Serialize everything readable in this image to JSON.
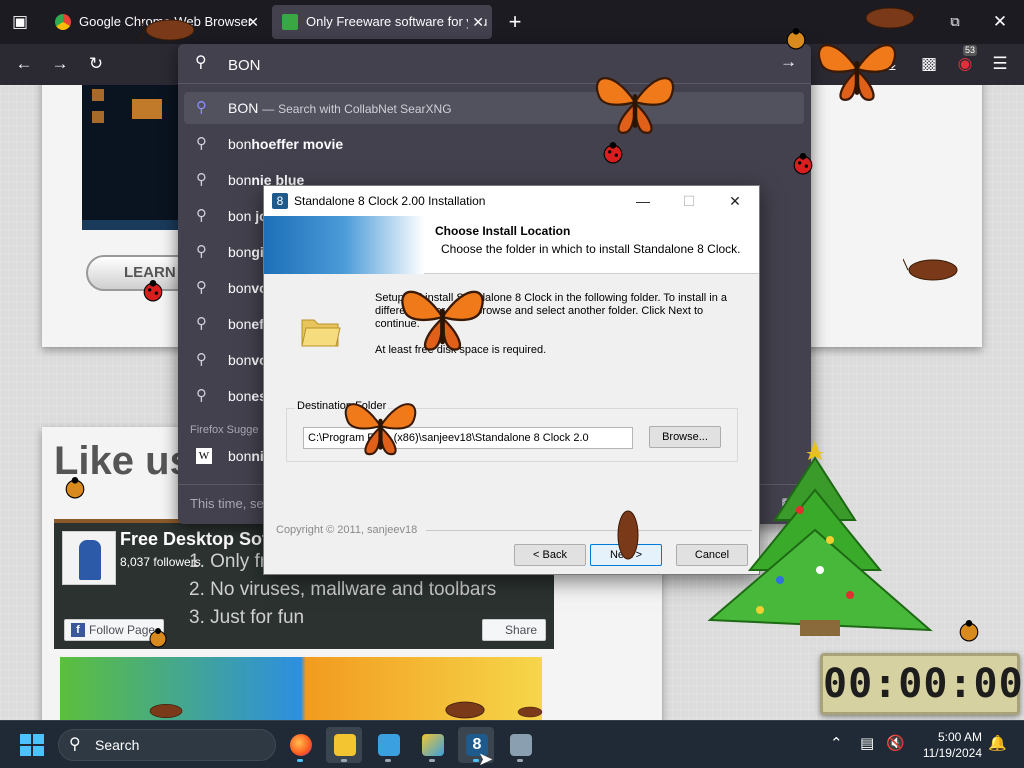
{
  "browser": {
    "tabs": [
      {
        "label": "Google Chrome Web Browser",
        "active": false
      },
      {
        "label": "Only Freeware software for you",
        "active": true
      }
    ],
    "extension_badge": "53"
  },
  "urlbar": {
    "query": "BON",
    "engine_suggestion": {
      "text": "BON",
      "separator": "—",
      "action": "Search with CollabNet SearXNG"
    },
    "suggestions": [
      {
        "prefix": "bon",
        "rest": "hoeffer movie"
      },
      {
        "prefix": "bon",
        "rest": "nie blue"
      },
      {
        "prefix": "bon ",
        "rest": "jo"
      },
      {
        "prefix": "bon",
        "rest": "gi"
      },
      {
        "prefix": "bon",
        "rest": "vo"
      },
      {
        "prefix": "bon",
        "rest": "ef"
      },
      {
        "prefix": "bon",
        "rest": "vo"
      },
      {
        "prefix": "bon",
        "rest": "es"
      }
    ],
    "firefox_heading": "Firefox Sugge",
    "firefox_item": {
      "prefix": "bon",
      "rest": "ni"
    },
    "footer": "This time, se"
  },
  "page": {
    "learn_more": "LEARN M",
    "like_us": "Like us",
    "facebook": {
      "name": "Free Desktop Soft",
      "followers": "8,037 followers",
      "lines": [
        "1. Only fre",
        "2. No viruses, mallware and toolbars",
        "3. Just for fun"
      ],
      "follow_label": "Follow Page",
      "share_label": "Share"
    }
  },
  "installer": {
    "title": "Standalone 8 Clock 2.00 Installation",
    "heading": "Choose Install Location",
    "subheading": "Choose the folder in which to install Standalone 8 Clock.",
    "body_line1": "Setup will install Standalone 8 Clock in the following folder. To install in a",
    "body_line2": "different folder, click Browse and select another folder. Click Next to",
    "body_line3": "continue.",
    "space_note": "At least free disk space is required.",
    "dest_label": "Destination Folder",
    "dest_path": "C:\\Program Files (x86)\\sanjeev18\\Standalone 8 Clock 2.0",
    "browse_label": "Browse...",
    "copyright": "Copyright © 2011, sanjeev18",
    "back_label": "< Back",
    "next_label": "Next >",
    "cancel_label": "Cancel"
  },
  "clock_widget": {
    "time": "00:00:00"
  },
  "taskbar": {
    "search_label": "Search",
    "time": "5:00 AM",
    "date": "11/19/2024"
  },
  "colors": {
    "accent_blue": "#0078d7",
    "firefox_dark": "#42414d",
    "taskbar": "#1f2a36",
    "butterfly_orange": "#f07a1a"
  }
}
